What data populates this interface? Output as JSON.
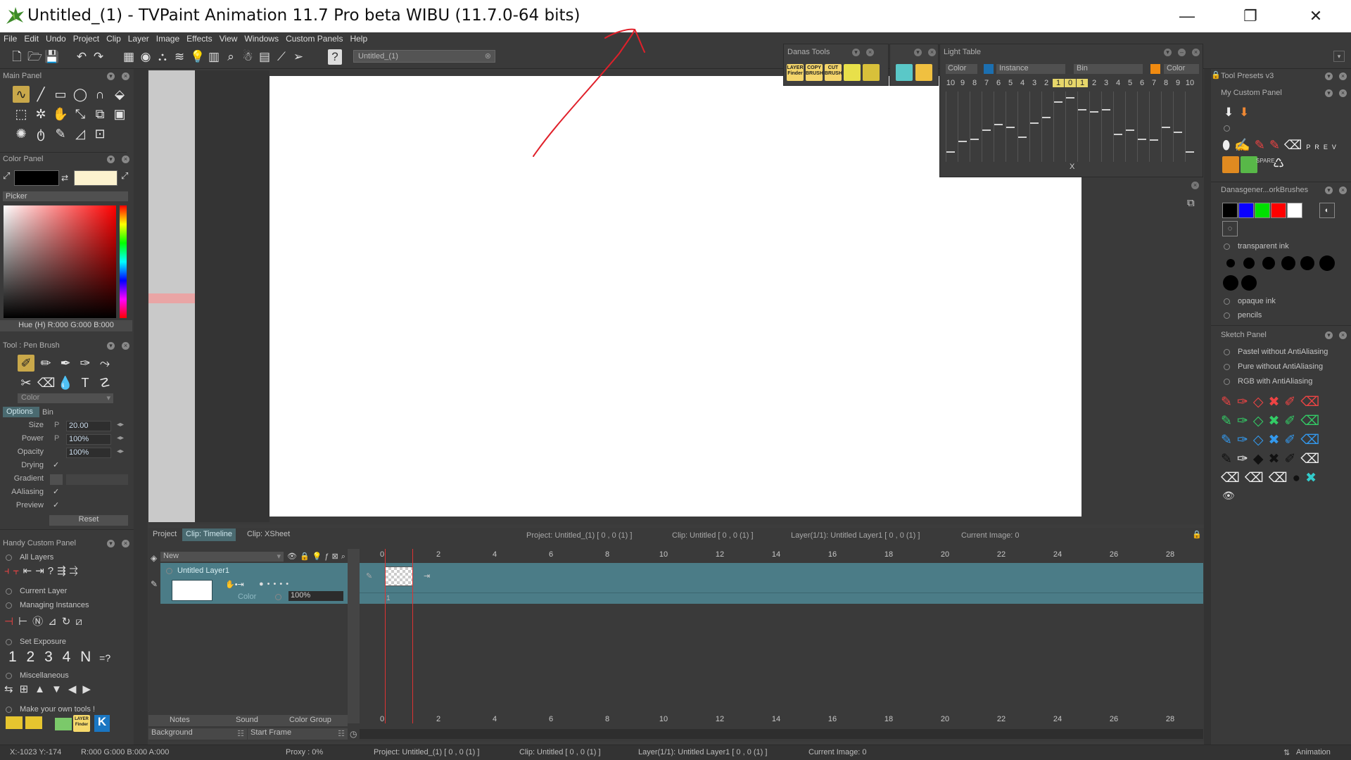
{
  "window": {
    "title": "Untitled_(1) - TVPaint Animation 11.7 Pro beta WIBU (11.7.0-64 bits)",
    "minimize": "—",
    "maximize": "❐",
    "close": "✕"
  },
  "menu": [
    "File",
    "Edit",
    "Undo",
    "Project",
    "Clip",
    "Layer",
    "Image",
    "Effects",
    "View",
    "Windows",
    "Custom Panels",
    "Help"
  ],
  "toolbar": {
    "project_tab": "Untitled_(1)",
    "help_icon": "?"
  },
  "main_panel": {
    "title": "Main Panel"
  },
  "color_panel": {
    "title": "Color Panel",
    "picker_label": "Picker",
    "primary_color": "#000000",
    "secondary_color": "#fcf2cf",
    "readout": "Hue (H) R:000 G:000 B:000"
  },
  "tool_panel": {
    "title": "Tool : Pen Brush",
    "mode": "Color",
    "tabs": [
      "Options",
      "Bin"
    ],
    "size_label": "Size",
    "size_value": "20.00",
    "power_label": "Power",
    "power_value": "100%",
    "opacity_label": "Opacity",
    "opacity_value": "100%",
    "drying_label": "Drying",
    "gradient_label": "Gradient",
    "aaliasing_label": "AAliasing",
    "preview_label": "Preview",
    "reset_label": "Reset",
    "p_letter": "P"
  },
  "handy_panel": {
    "title": "Handy Custom Panel",
    "all_layers": "All Layers",
    "current_layer": "Current Layer",
    "managing_instances": "Managing Instances",
    "set_exposure": "Set Exposure",
    "exposure_numbers": [
      "1",
      "2",
      "3",
      "4",
      "N",
      "=?"
    ],
    "miscellaneous": "Miscellaneous",
    "make_your_own": "Make your own tools !"
  },
  "danas_tools": {
    "title": "Danas Tools",
    "buttons": [
      "LAYER Finder",
      "COPY BRUSH",
      "CUT BRUSH"
    ]
  },
  "light_table": {
    "title": "Light Table",
    "color_label": "Color",
    "instance_label": "Instance",
    "bin_label": "Bin",
    "color_label2": "Color",
    "numbers_left": [
      "10",
      "9",
      "8",
      "7",
      "6",
      "5",
      "4",
      "3",
      "2",
      "1"
    ],
    "center": "0",
    "numbers_right": [
      "1",
      "2",
      "3",
      "4",
      "5",
      "6",
      "7",
      "8",
      "9",
      "10"
    ],
    "x_label": "X"
  },
  "right_panels": {
    "tool_presets": "Tool Presets v3",
    "my_custom_panel": "My Custom Panel",
    "danasgener": "Danasgener...orkBrushes",
    "transparent_ink": "transparent ink",
    "opaque_ink": "opaque ink",
    "pencils": "pencils",
    "sketch_panel": "Sketch Panel",
    "sketch_items": [
      "Pastel without AntiAliasing",
      "Pure without AntiAliasing",
      "RGB with AntiAliasing"
    ],
    "swatches": [
      "#000000",
      "#0a00ff",
      "#00e000",
      "#ff0000",
      "#ffffff"
    ]
  },
  "timeline": {
    "tabs": [
      "Project",
      "Clip: Timeline",
      "Clip: XSheet"
    ],
    "project_info": "Project: Untitled_(1) [ 0 , 0  (1) ]",
    "clip_info": "Clip: Untitled [ 0 , 0  (1) ]",
    "layer_info": "Layer(1/1): Untitled Layer1 [ 0 , 0  (1) ]",
    "current_image": "Current Image: 0",
    "new_label": "New",
    "layer_name": "Untitled Layer1",
    "layer_mode": "Color",
    "layer_opacity": "100%",
    "frame_numbers": [
      "0",
      "2",
      "4",
      "6",
      "8",
      "10",
      "12",
      "14",
      "16",
      "18",
      "20",
      "22",
      "24",
      "26",
      "28"
    ],
    "frame_one": "1",
    "bottom_tabs": [
      "Notes",
      "Sound",
      "Color Group"
    ],
    "background_label": "Background",
    "start_frame_label": "Start Frame"
  },
  "statusbar": {
    "coords": "X:-1023  Y:-174",
    "rgba": "R:000 G:000 B:000 A:000",
    "proxy": "Proxy : 0%",
    "project": "Project: Untitled_(1) [ 0 , 0  (1) ]",
    "clip": "Clip: Untitled [ 0 , 0  (1) ]",
    "layer": "Layer(1/1): Untitled Layer1 [ 0 , 0  (1) ]",
    "current_image": "Current Image: 0",
    "mode": "Animation"
  }
}
